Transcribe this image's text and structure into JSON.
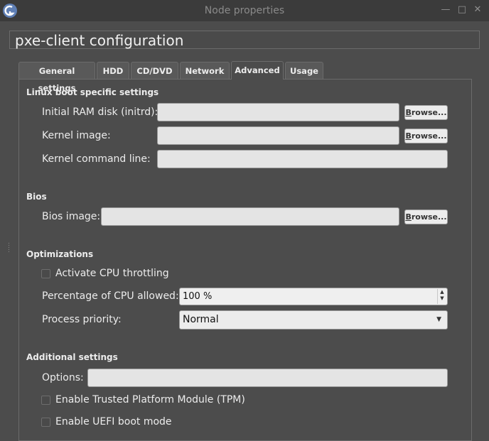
{
  "window": {
    "title": "Node properties",
    "minimize_icon": "minimize-icon",
    "maximize_icon": "maximize-icon",
    "close_icon": "close-icon",
    "app_icon": "gns3-app-icon"
  },
  "node_title": "pxe-client configuration",
  "tabs": [
    {
      "label": "General settings",
      "active": false
    },
    {
      "label": "HDD",
      "active": false
    },
    {
      "label": "CD/DVD",
      "active": false
    },
    {
      "label": "Network",
      "active": false
    },
    {
      "label": "Advanced",
      "active": true
    },
    {
      "label": "Usage",
      "active": false
    }
  ],
  "linux_boot": {
    "heading": "Linux boot specific settings",
    "initrd_label": "Initial RAM disk (initrd):",
    "initrd_value": "",
    "kernel_label": "Kernel image:",
    "kernel_value": "",
    "cmdline_label": "Kernel command line:",
    "cmdline_value": ""
  },
  "bios": {
    "heading": "Bios",
    "image_label": "Bios image:",
    "image_value": ""
  },
  "browse_label_underlined": "B",
  "browse_label_rest": "rowse...",
  "optimizations": {
    "heading": "Optimizations",
    "cpu_throttling_label": "Activate CPU throttling",
    "cpu_throttling_checked": false,
    "cpu_percent_label": "Percentage of CPU allowed:",
    "cpu_percent_value": "100 %",
    "priority_label": "Process priority:",
    "priority_value": "Normal"
  },
  "additional": {
    "heading": "Additional settings",
    "options_label": "Options:",
    "options_value": "",
    "tpm_label": "Enable Trusted Platform Module (TPM)",
    "tpm_checked": false,
    "uefi_label": "Enable UEFI boot mode",
    "uefi_checked": false
  }
}
